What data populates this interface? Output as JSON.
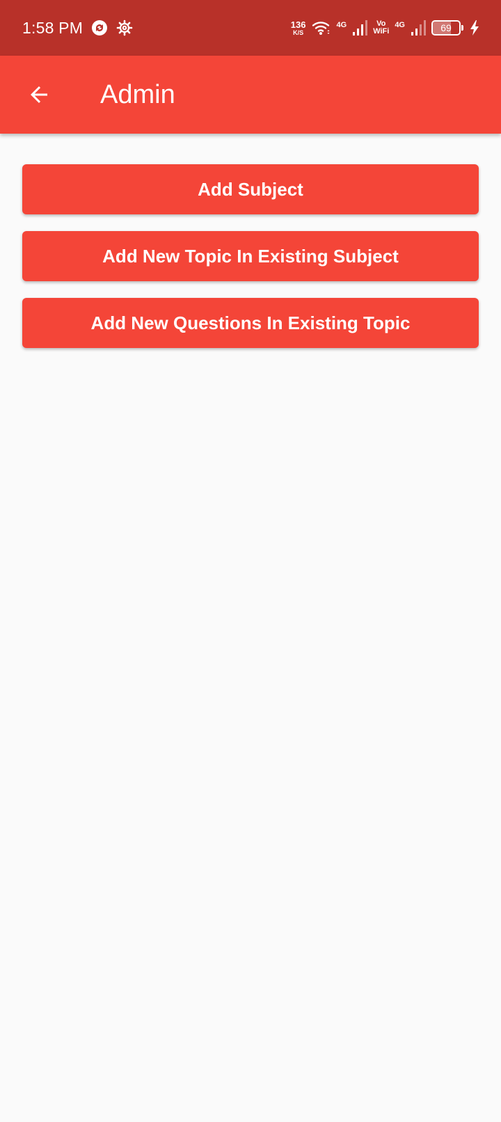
{
  "status_bar": {
    "time": "1:58 PM",
    "net_speed": "136",
    "net_speed_unit": "K/S",
    "sim1_label": "4G",
    "vowifi_top": "Vo",
    "vowifi_bottom": "WiFi",
    "sim2_label": "4G",
    "battery_level": "69",
    "battery_fraction": 0.69,
    "icons": [
      "sync-icon",
      "settings-gear-icon",
      "wifi-icon",
      "signal-icon",
      "signal-icon",
      "battery-icon",
      "charging-bolt-icon"
    ]
  },
  "app_bar": {
    "title": "Admin",
    "back_icon": "arrow-back-icon"
  },
  "actions": [
    {
      "label": "Add Subject"
    },
    {
      "label": "Add New Topic In Existing Subject"
    },
    {
      "label": "Add New Questions In Existing Topic"
    }
  ],
  "colors": {
    "status_bar": "#B83129",
    "primary": "#F44538",
    "background": "#FAFAFA",
    "on_primary": "#FFFFFF"
  }
}
